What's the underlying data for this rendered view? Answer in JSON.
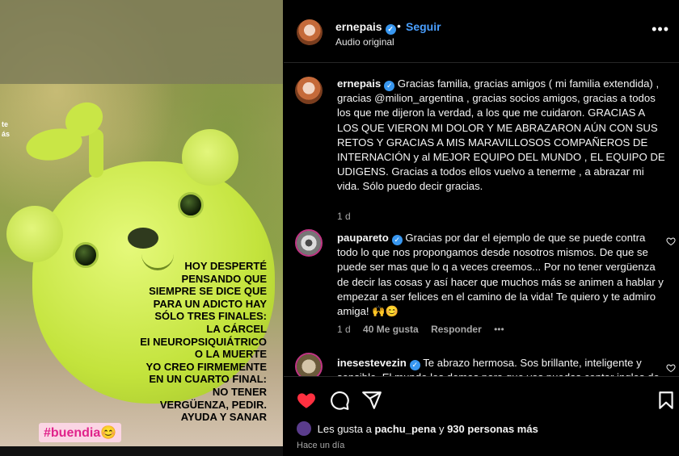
{
  "media": {
    "edge_text_1": "te",
    "edge_text_2": "ás",
    "story_lines": [
      "HOY DESPERTÉ",
      "PENSANDO QUE",
      "SIEMPRE SE DICE QUE",
      "PARA UN ADICTO HAY",
      "SÓLO TRES FINALES:",
      "LA CÁRCEL",
      "EI NEUROPSIQUIÁTRICO",
      "O LA MUERTE",
      "YO CREO FIRMEMENTE",
      "EN UN CUARTO FINAL:",
      "NO TENER",
      "VERGÜENZA, PEDIR.",
      "AYUDA Y SANAR"
    ],
    "hashtag": "#buendia😊"
  },
  "header": {
    "username": "ernepais",
    "separator": "•",
    "follow_label": "Seguir",
    "audio_label": "Audio original",
    "more_icon": "more-horizontal-icon"
  },
  "comments": [
    {
      "user": "ernepais",
      "text": "Gracias familia, gracias amigos ( mi familia extendida) , gracias @milion_argentina , gracias socios amigos, gracias a todos los que me dijeron la verdad, a los que me cuidaron. GRACIAS A LOS QUE VIERON MI DOLOR Y ME ABRAZARON AÚN CON SUS RETOS Y GRACIAS A MIS MARAVILLOSOS COMPAÑEROS DE INTERNACIÓN y al MEJOR EQUIPO DEL MUNDO , EL EQUIPO DE UDIGENS. Gracias a todos ellos vuelvo a tenerme , a abrazar mi vida. Sólo puedo decir gracias.",
      "time": "1 d"
    },
    {
      "user": "paupareto",
      "text": "Gracias por dar el ejemplo de que se puede contra todo lo que nos propongamos desde nosotros mismos. De que se puede ser mas que lo q a veces creemos... Por no tener vergüenza de decir las cosas y así hacer que muchos más se animen a hablar y empezar a ser felices en el camino de la vida! Te quiero y te admiro amiga! 🙌😊",
      "time": "1 d",
      "likes": "40 Me gusta",
      "reply_label": "Responder",
      "more": "•••"
    },
    {
      "user": "inesestevezin",
      "text": "Te abrazo hermosa. Sos brillante, inteligente y sensible. El mundo los demas para que vos puedas contar ingles de"
    }
  ],
  "actions": {
    "like_icon": "heart-filled-icon",
    "comment_icon": "comment-icon",
    "share_icon": "share-icon",
    "save_icon": "bookmark-icon",
    "likes_prefix": "Les gusta a",
    "likes_user": "pachu_pena",
    "likes_joiner": "y",
    "likes_others": "930 personas más",
    "timestamp": "Hace un día"
  },
  "colors": {
    "background": "#000000",
    "verified": "#3897f0",
    "follow": "#4a9fff",
    "like": "#ff3040",
    "hashtag_bg": "#fbd5e4",
    "hashtag_text": "#e0238b"
  }
}
